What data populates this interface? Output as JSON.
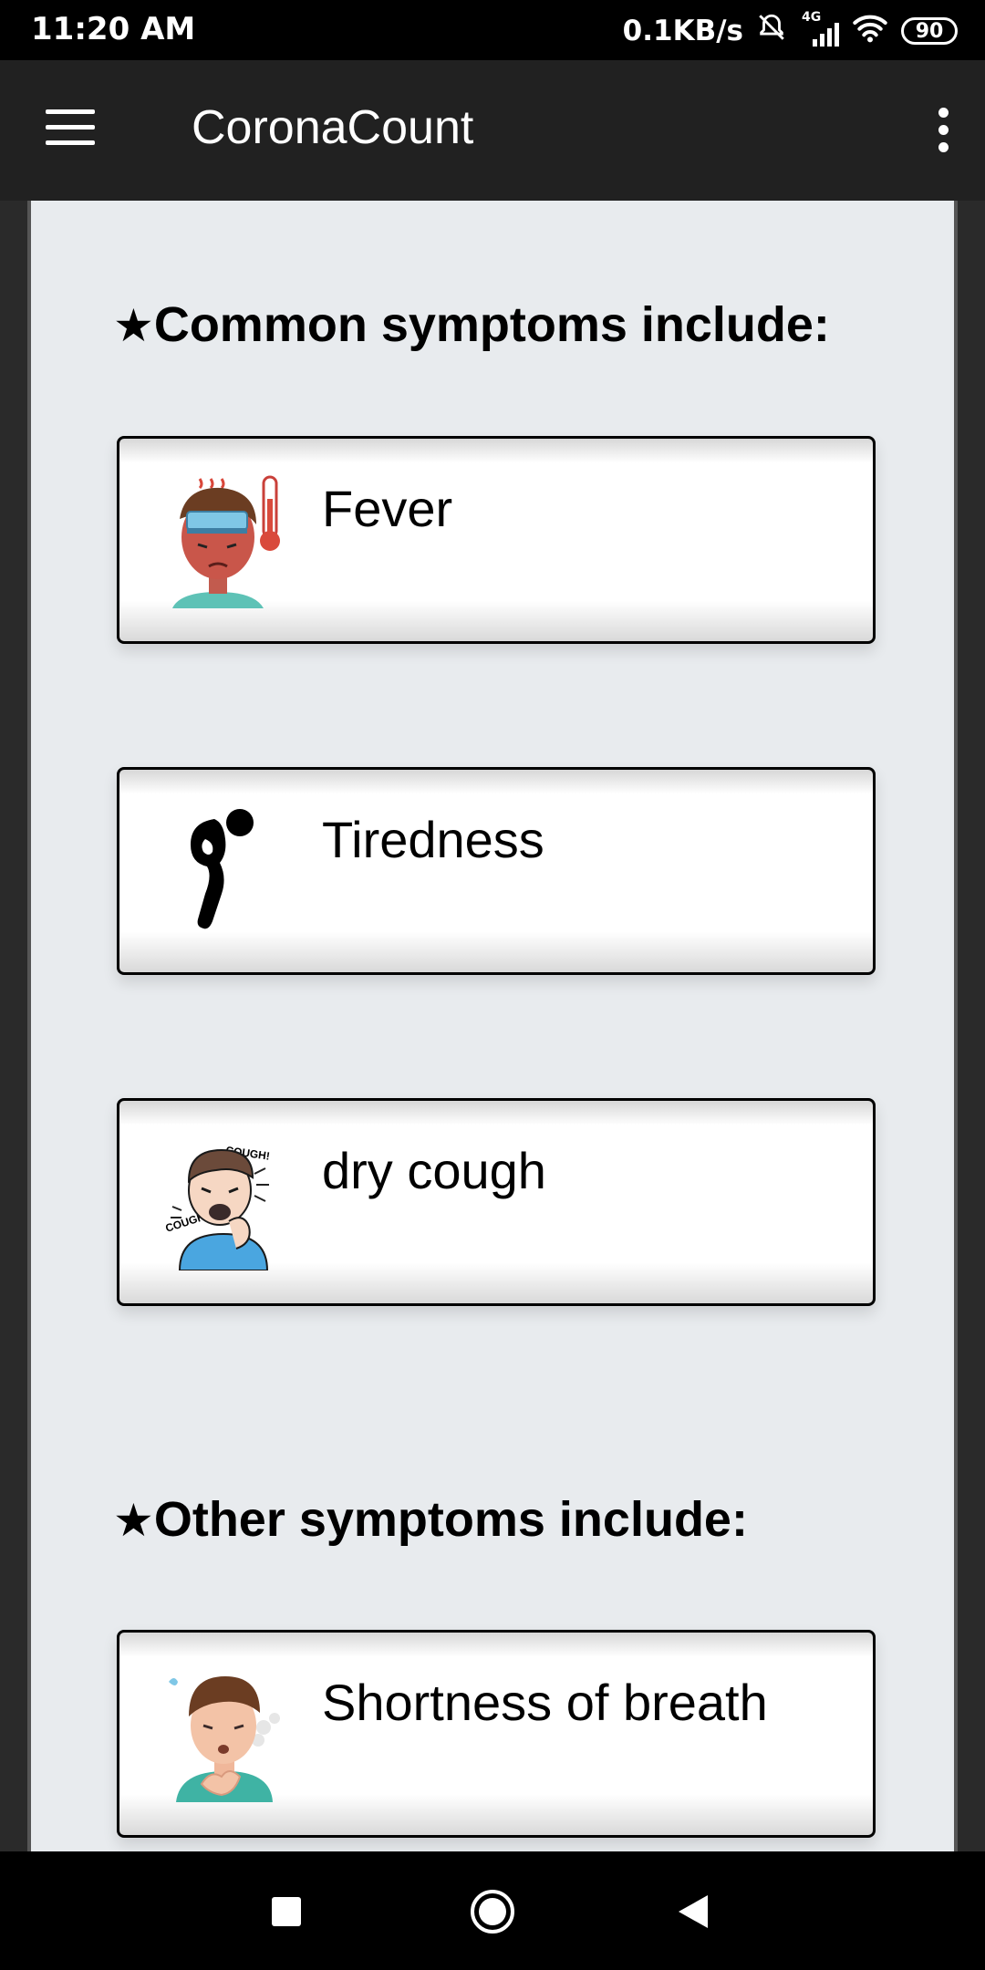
{
  "status_bar": {
    "time": "11:20 AM",
    "network_speed": "0.1KB/s",
    "network_type": "4G",
    "battery": "90"
  },
  "app_bar": {
    "title": "CoronaCount"
  },
  "common": {
    "heading_star": "★",
    "heading": "Common symptoms include:",
    "items": [
      {
        "label": "Fever",
        "icon": "fever-icon"
      },
      {
        "label": "Tiredness",
        "icon": "tiredness-icon"
      },
      {
        "label": "dry cough",
        "icon": "cough-icon"
      }
    ]
  },
  "other": {
    "heading_star": "★",
    "heading": "Other symptoms include:",
    "items": [
      {
        "label": "Shortness of breath",
        "icon": "shortness-of-breath-icon"
      }
    ]
  },
  "nav": {
    "recents": "recents-icon",
    "home": "home-icon",
    "back": "back-icon"
  }
}
